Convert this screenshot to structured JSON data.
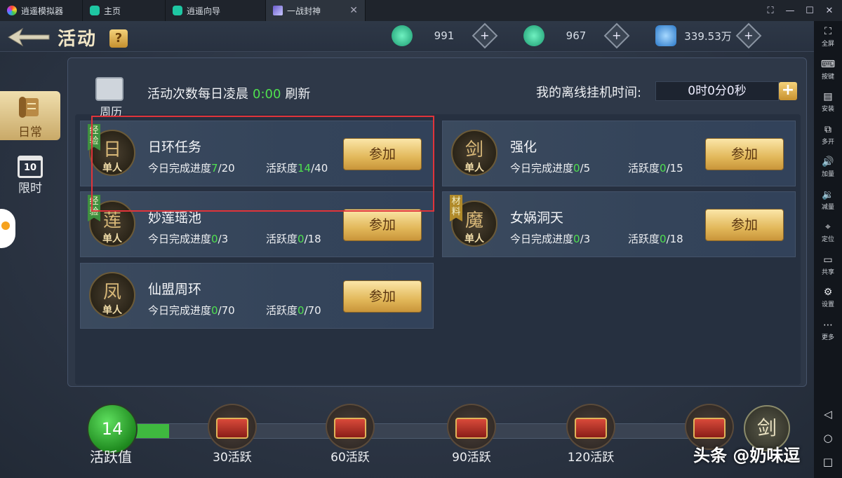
{
  "window": {
    "app_name": "逍遥模拟器",
    "tabs": [
      {
        "label": "主页"
      },
      {
        "label": "逍遥向导"
      },
      {
        "label": "一战封神"
      }
    ],
    "controls": [
      "⛶",
      "—",
      "☐",
      "✕"
    ]
  },
  "game": {
    "title": "活动",
    "help_label": "?",
    "currencies": [
      {
        "icon": "jade-coin-icon",
        "value": "991",
        "color": "#2fcf9a"
      },
      {
        "icon": "jade-dragon-icon",
        "value": "967",
        "color": "#2fcf9a"
      },
      {
        "icon": "crystal-icon",
        "value": "339.53万",
        "color": "#4aa8e8"
      }
    ],
    "side_tabs": [
      {
        "label": "日常",
        "active": true
      },
      {
        "label": "限时",
        "icon_text": "10",
        "active": false
      }
    ],
    "calendar_label": "周历",
    "refresh": {
      "prefix": "活动次数每日凌晨",
      "time": "0:00",
      "suffix": "刷新"
    },
    "offline": {
      "label": "我的离线挂机时间:",
      "value": "0时0分0秒",
      "plus": "+"
    },
    "activities": [
      {
        "name": "日环任务",
        "tag": "经验",
        "icon_glyph": "日",
        "solo": "单人",
        "progress_label": "今日完成进度",
        "progress_done": "7",
        "progress_total": "/20",
        "activity_label": "活跃度",
        "activity_done": "14",
        "activity_total": "/40",
        "button": "参加"
      },
      {
        "name": "强化",
        "tag": "",
        "icon_glyph": "剑",
        "solo": "单人",
        "progress_label": "今日完成进度",
        "progress_done": "0",
        "progress_total": "/5",
        "activity_label": "活跃度",
        "activity_done": "0",
        "activity_total": "/15",
        "button": "参加"
      },
      {
        "name": "妙莲瑶池",
        "tag": "经验",
        "icon_glyph": "莲",
        "solo": "单人",
        "progress_label": "今日完成进度",
        "progress_done": "0",
        "progress_total": "/3",
        "activity_label": "活跃度",
        "activity_done": "0",
        "activity_total": "/18",
        "button": "参加"
      },
      {
        "name": "女娲洞天",
        "tag": "材料",
        "icon_glyph": "魔",
        "solo": "单人",
        "progress_label": "今日完成进度",
        "progress_done": "0",
        "progress_total": "/3",
        "activity_label": "活跃度",
        "activity_done": "0",
        "activity_total": "/18",
        "button": "参加"
      },
      {
        "name": "仙盟周环",
        "tag": "",
        "icon_glyph": "凤",
        "solo": "单人",
        "progress_label": "今日完成进度",
        "progress_done": "0",
        "progress_total": "/70",
        "activity_label": "活跃度",
        "activity_done": "0",
        "activity_total": "/70",
        "button": "参加"
      }
    ],
    "activity_score": {
      "value": "14",
      "label": "活跃值",
      "fraction": 0.06
    },
    "chests": [
      {
        "label": "30活跃"
      },
      {
        "label": "60活跃"
      },
      {
        "label": "90活跃"
      },
      {
        "label": "120活跃"
      },
      {
        "label": ""
      }
    ],
    "final_reward_glyph": "剑",
    "watermark": "头条 @奶味逗"
  },
  "emulator_sidebar": [
    {
      "icon": "fullscreen-icon",
      "glyph": "⛶",
      "label": "全屏"
    },
    {
      "icon": "keyboard-icon",
      "glyph": "⌨",
      "label": "按键"
    },
    {
      "icon": "apk-icon",
      "glyph": "▤",
      "label": "安装"
    },
    {
      "icon": "multi-icon",
      "glyph": "⧉",
      "label": "多开"
    },
    {
      "icon": "volume-up-icon",
      "glyph": "🔊",
      "label": "加量"
    },
    {
      "icon": "volume-down-icon",
      "glyph": "🔉",
      "label": "减量"
    },
    {
      "icon": "location-icon",
      "glyph": "⌖",
      "label": "定位"
    },
    {
      "icon": "folder-icon",
      "glyph": "▭",
      "label": "共享"
    },
    {
      "icon": "gear-icon",
      "glyph": "⚙",
      "label": "设置"
    },
    {
      "icon": "more-icon",
      "glyph": "⋯",
      "label": "更多"
    }
  ],
  "android_nav": [
    "◁",
    "○",
    "□"
  ]
}
